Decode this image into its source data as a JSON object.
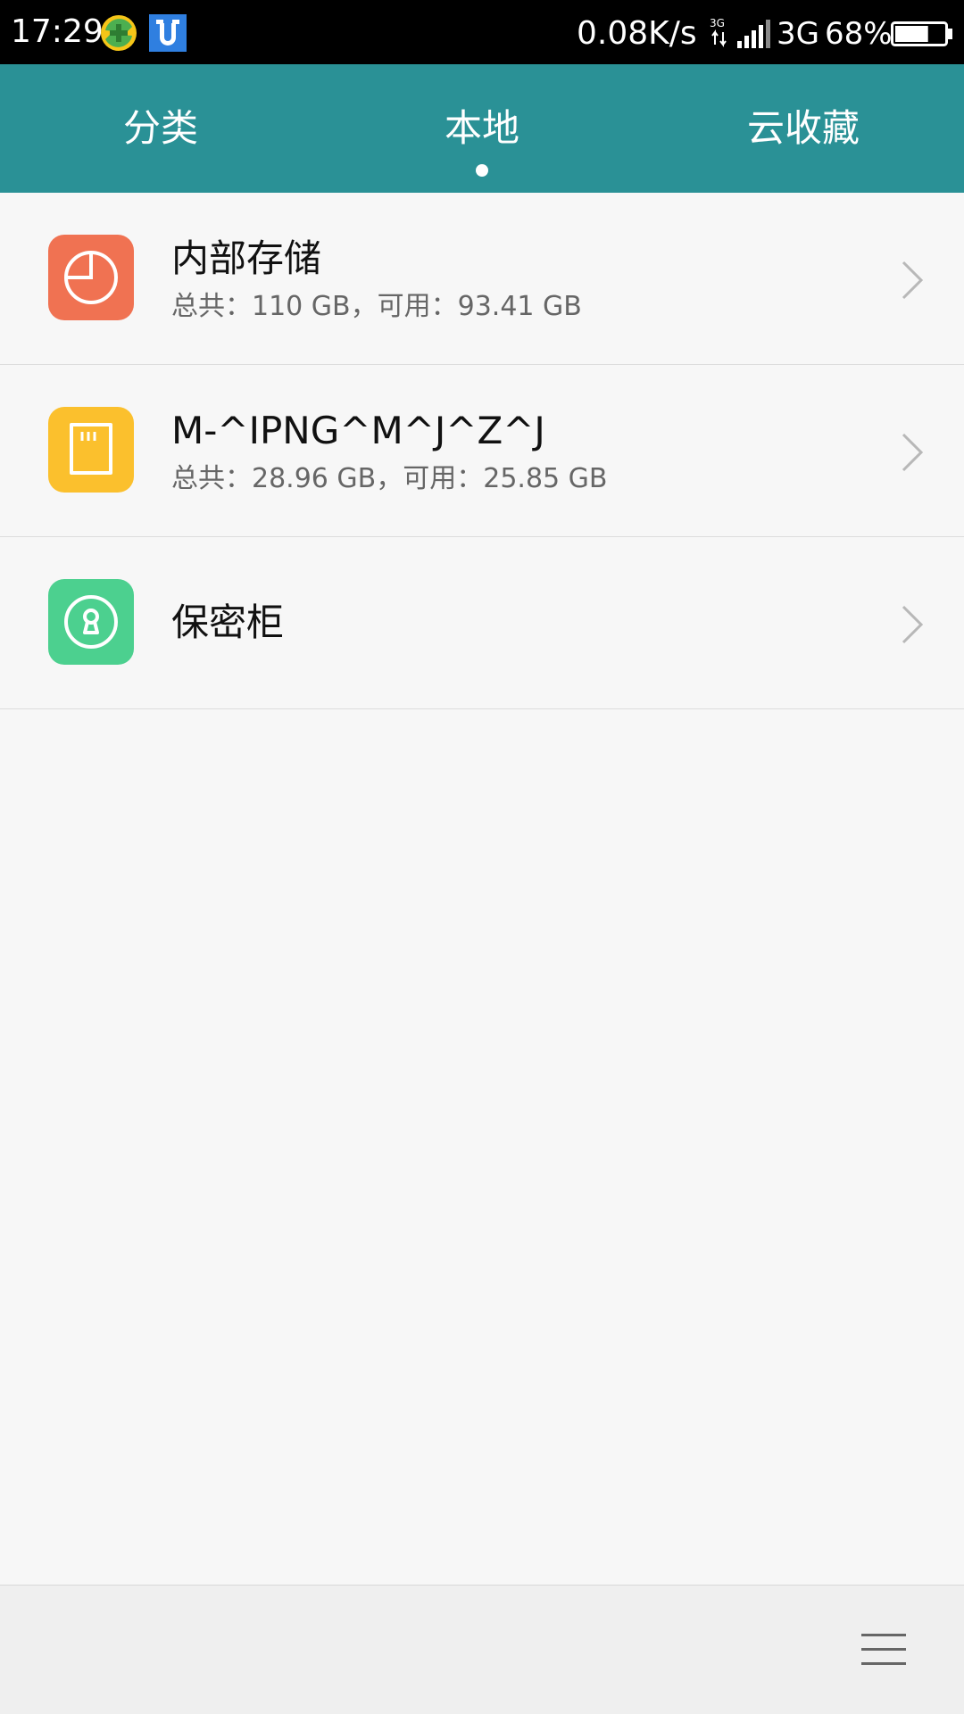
{
  "status_bar": {
    "time": "17:29",
    "net_speed": "0.08K/s",
    "network_small": "3G",
    "network_type": "3G",
    "battery_percent": "68%",
    "battery_level": 0.68,
    "app_icons": [
      "add-app-icon",
      "notification-app-icon"
    ]
  },
  "tabs": [
    {
      "label": "分类",
      "active": false
    },
    {
      "label": "本地",
      "active": true
    },
    {
      "label": "云收藏",
      "active": false
    }
  ],
  "storage": [
    {
      "title": "内部存储",
      "subtitle": "总共：110 GB，可用：93.41 GB",
      "icon": "pie-chart-icon",
      "color": "#f07252"
    },
    {
      "title": "M-^IPNG^M^J^Z^J",
      "subtitle": "总共：28.96 GB，可用：25.85 GB",
      "icon": "sd-card-icon",
      "color": "#fbc02d"
    },
    {
      "title": "保密柜",
      "subtitle": "",
      "icon": "lock-icon",
      "color": "#4cd08f"
    }
  ],
  "colors": {
    "header": "#2a9196",
    "background": "#f7f7f7"
  }
}
